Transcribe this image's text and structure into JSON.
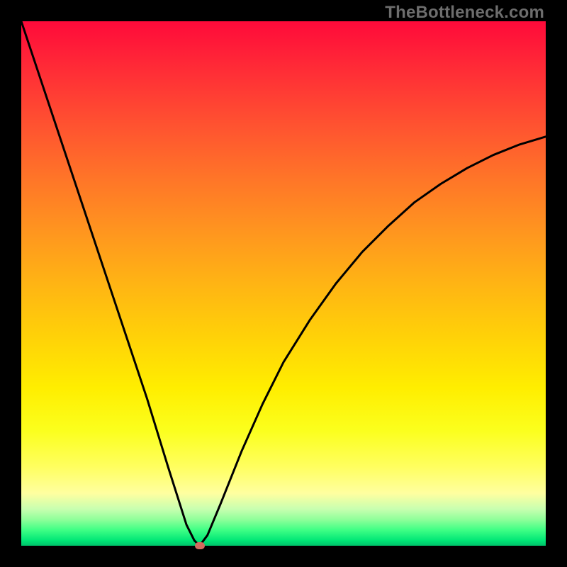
{
  "watermark": "TheBottleneck.com",
  "chart_data": {
    "type": "line",
    "title": "",
    "xlabel": "",
    "ylabel": "",
    "xlim": [
      0,
      100
    ],
    "ylim": [
      0,
      100
    ],
    "grid": false,
    "colors": {
      "gradient_top": "#ff0a3a",
      "gradient_bottom": "#00c36b",
      "curve": "#000000",
      "marker": "#d46a5f",
      "frame": "#000000",
      "watermark": "#6d6d6d"
    },
    "series": [
      {
        "name": "bottleneck-curve",
        "x": [
          0,
          4,
          8,
          12,
          16,
          20,
          24,
          28,
          31.5,
          33,
          34,
          35.5,
          38,
          42,
          46,
          50,
          55,
          60,
          65,
          70,
          75,
          80,
          85,
          90,
          95,
          100
        ],
        "y": [
          100,
          88,
          76,
          64,
          52,
          40,
          28,
          15,
          4,
          1,
          0,
          2,
          8,
          18,
          27,
          35,
          43,
          50,
          56,
          61,
          65.5,
          69,
          72,
          74.5,
          76.5,
          78
        ]
      }
    ],
    "marker": {
      "name": "optimal-point",
      "x": 34,
      "y": 0
    }
  }
}
